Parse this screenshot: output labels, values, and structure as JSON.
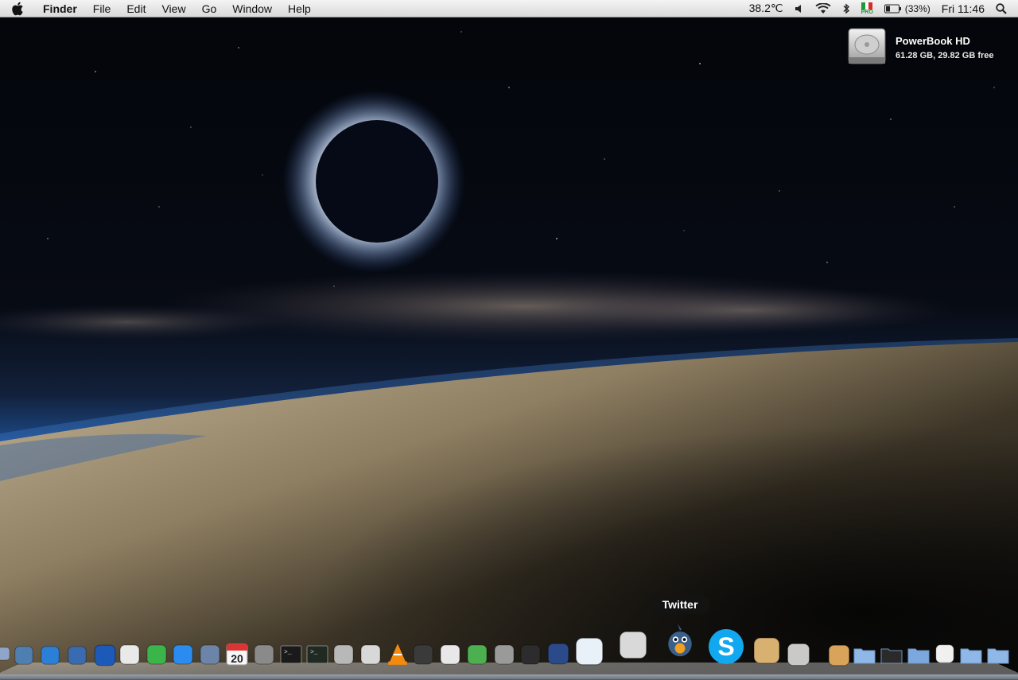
{
  "menubar": {
    "apple_icon": "apple-icon",
    "app_name": "Finder",
    "menus": [
      "File",
      "Edit",
      "View",
      "Go",
      "Window",
      "Help"
    ],
    "status": {
      "temperature": "38.2℃",
      "battery_percent": "(33%)",
      "clock": "Fri 11:46",
      "input_flag": "PRO"
    }
  },
  "desktop": {
    "drive": {
      "name": "PowerBook HD",
      "info": "61.28 GB, 29.82 GB free"
    }
  },
  "dock": {
    "tooltip": "Twitter",
    "items": [
      "preview",
      "mail-stamp",
      "safari",
      "network-utility",
      "world-globe",
      "textedit",
      "leaf-app",
      "itunes",
      "image-capture",
      "ical",
      "system-preferences",
      "terminal",
      "activity-monitor",
      "disk-utility",
      "rocket-app",
      "vlc",
      "dvd-player",
      "script-editor",
      "dreamweaver",
      "calculator",
      "final-cut",
      "typography-app",
      "quill-app",
      "classic-mac",
      "twitter",
      "skype",
      "stuffit",
      "pdf-app",
      "downloads-stack",
      "folder",
      "folder-dark",
      "folder-sync",
      "zip-file",
      "documents-folder",
      "applications-folder"
    ]
  }
}
